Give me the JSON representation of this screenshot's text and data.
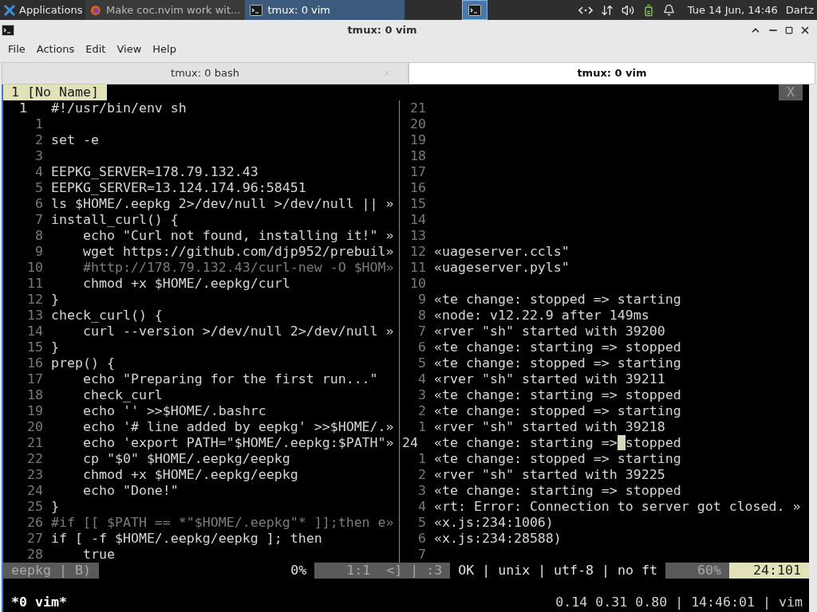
{
  "panel": {
    "apps_label": "Applications",
    "tasks": [
      {
        "label": "Make coc.nvim work wit...",
        "selected": false,
        "kind": "browser"
      },
      {
        "label": "tmux: 0 vim",
        "selected": true,
        "kind": "terminal"
      }
    ],
    "clock": "Tue 14 Jun, 14:46",
    "user": "Dartz"
  },
  "window": {
    "title": "tmux: 0 vim"
  },
  "menu": [
    "File",
    "Actions",
    "Edit",
    "View",
    "Help"
  ],
  "tabs": [
    {
      "label": "tmux: 0 bash",
      "selected": false
    },
    {
      "label": "tmux: 0 vim",
      "selected": true
    }
  ],
  "vim": {
    "buffer_tab": "1 [No Name]",
    "close_label": "X",
    "left_pane": {
      "rows": [
        {
          "num": "1",
          "current": true,
          "kind": "code",
          "text": "#!/usr/bin/env sh"
        },
        {
          "num": "1",
          "current": false,
          "kind": "code"
        },
        {
          "num": "2",
          "current": false,
          "kind": "code",
          "text": "set -e"
        },
        {
          "num": "3",
          "current": false,
          "kind": "code"
        },
        {
          "num": "4",
          "current": false,
          "kind": "code",
          "text": "EEPKG_SERVER=178.79.132.43"
        },
        {
          "num": "5",
          "current": false,
          "kind": "code",
          "text": "EEPKG_SERVER=13.124.174.96:58451"
        },
        {
          "num": "6",
          "current": false,
          "kind": "code",
          "text": "ls $HOME/.eepkg 2>/dev/null >/dev/null || »"
        },
        {
          "num": "7",
          "current": false,
          "kind": "code",
          "text": "install_curl() {"
        },
        {
          "num": "8",
          "current": false,
          "kind": "code",
          "text": "    echo \"Curl not found, installing it!\" »"
        },
        {
          "num": "9",
          "current": false,
          "kind": "code",
          "text": "    wget https://github.com/djp952/prebuil»"
        },
        {
          "num": "10",
          "current": false,
          "kind": "comment",
          "text": "    #http://178.79.132.43/curl-new -O $HOM»"
        },
        {
          "num": "11",
          "current": false,
          "kind": "code",
          "text": "    chmod +x $HOME/.eepkg/curl"
        },
        {
          "num": "12",
          "current": false,
          "kind": "code",
          "text": "}"
        },
        {
          "num": "13",
          "current": false,
          "kind": "code",
          "text": "check_curl() {"
        },
        {
          "num": "14",
          "current": false,
          "kind": "code",
          "text": "    curl --version >/dev/null 2>/dev/null »"
        },
        {
          "num": "15",
          "current": false,
          "kind": "code",
          "text": "}"
        },
        {
          "num": "16",
          "current": false,
          "kind": "code",
          "text": "prep() {"
        },
        {
          "num": "17",
          "current": false,
          "kind": "code",
          "text": "    echo \"Preparing for the first run...\""
        },
        {
          "num": "18",
          "current": false,
          "kind": "code",
          "text": "    check_curl"
        },
        {
          "num": "19",
          "current": false,
          "kind": "code",
          "text": "    echo '' >>$HOME/.bashrc"
        },
        {
          "num": "20",
          "current": false,
          "kind": "code",
          "text": "    echo '# line added by eepkg' >>$HOME/.»"
        },
        {
          "num": "21",
          "current": false,
          "kind": "code",
          "text": "    echo 'export PATH=\"$HOME/.eepkg:$PATH\"»"
        },
        {
          "num": "22",
          "current": false,
          "kind": "code",
          "text": "    cp \"$0\" $HOME/.eepkg/eepkg"
        },
        {
          "num": "23",
          "current": false,
          "kind": "code",
          "text": "    chmod +x $HOME/.eepkg/eepkg"
        },
        {
          "num": "24",
          "current": false,
          "kind": "code",
          "text": "    echo \"Done!\""
        },
        {
          "num": "25",
          "current": false,
          "kind": "code",
          "text": "}"
        },
        {
          "num": "26",
          "current": false,
          "kind": "comment",
          "text": "#if [[ $PATH == *\"$HOME/.eepkg\"* ]];then e»"
        },
        {
          "num": "27",
          "current": false,
          "kind": "code",
          "text": "if [ -f $HOME/.eepkg/eepkg ]; then"
        },
        {
          "num": "28",
          "current": false,
          "kind": "code",
          "text": "    true"
        }
      ]
    },
    "right_pane": {
      "rows": [
        {
          "num": "21",
          "current": false
        },
        {
          "num": "20",
          "current": false
        },
        {
          "num": "19",
          "current": false
        },
        {
          "num": "18",
          "current": false
        },
        {
          "num": "17",
          "current": false
        },
        {
          "num": "16",
          "current": false
        },
        {
          "num": "15",
          "current": false
        },
        {
          "num": "14",
          "current": false
        },
        {
          "num": "13",
          "current": false
        },
        {
          "num": "12",
          "current": false,
          "text": "«uageserver.ccls\""
        },
        {
          "num": "11",
          "current": false,
          "text": "«uageserver.pyls\""
        },
        {
          "num": "10",
          "current": false
        },
        {
          "num": "9",
          "current": false,
          "text": "«te change: stopped => starting"
        },
        {
          "num": "8",
          "current": false,
          "text": "«node: v12.22.9 after 149ms"
        },
        {
          "num": "7",
          "current": false,
          "text": "«rver \"sh\" started with 39200"
        },
        {
          "num": "6",
          "current": false,
          "text": "«te change: starting => stopped"
        },
        {
          "num": "5",
          "current": false,
          "text": "«te change: stopped => starting"
        },
        {
          "num": "4",
          "current": false,
          "text": "«rver \"sh\" started with 39211"
        },
        {
          "num": "3",
          "current": false,
          "text": "«te change: starting => stopped"
        },
        {
          "num": "2",
          "current": false,
          "text": "«te change: stopped => starting"
        },
        {
          "num": "1",
          "current": false,
          "text": "«rver \"sh\" started with 39218"
        },
        {
          "num": "24",
          "current": true,
          "text": "«te change: starting =>",
          "cursor": " ",
          "after": "stopped"
        },
        {
          "num": "1",
          "current": false,
          "text": "«te change: stopped => starting"
        },
        {
          "num": "2",
          "current": false,
          "text": "«rver \"sh\" started with 39225"
        },
        {
          "num": "3",
          "current": false,
          "text": "«te change: starting => stopped"
        },
        {
          "num": "4",
          "current": false,
          "text": "«rt: Error: Connection to server got closed. »"
        },
        {
          "num": "5",
          "current": false,
          "text": "«x.js:234:1006)"
        },
        {
          "num": "6",
          "current": false,
          "text": "«x.js:234:28588)"
        },
        {
          "num": "7",
          "current": false
        }
      ]
    },
    "statusline": {
      "left": {
        "text": "eepkg | B)",
        "kind": "dim"
      },
      "right": [
        {
          "text": "0%",
          "kind": "plain"
        },
        {
          "text": "1:1",
          "kind": "dim"
        },
        {
          "text": "<] | :3",
          "kind": "dim"
        },
        {
          "text": "OK | unix | utf-8 | no ft",
          "kind": "plain"
        },
        {
          "text": "60%",
          "kind": "dim"
        },
        {
          "text": "24:101",
          "kind": "highlight"
        }
      ]
    }
  },
  "tmux_status": {
    "left": "*0 vim*",
    "right": "0.14 0.31 0.80 | 14:46:01 | vim"
  }
}
